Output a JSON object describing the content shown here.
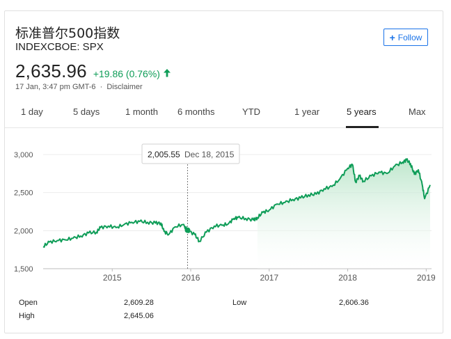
{
  "header": {
    "title": "标准普尔500指数",
    "ticker": "INDEXCBOE: SPX",
    "follow_label": "Follow"
  },
  "quote": {
    "price": "2,635.96",
    "change": "+19.86 (0.76%)",
    "timestamp": "17 Jan, 3:47 pm GMT-6",
    "separator": "·",
    "disclaimer": "Disclaimer"
  },
  "tabs": [
    {
      "label": "1 day"
    },
    {
      "label": "5 days"
    },
    {
      "label": "1 month"
    },
    {
      "label": "6 months"
    },
    {
      "label": "YTD"
    },
    {
      "label": "1 year"
    },
    {
      "label": "5 years",
      "active": true
    },
    {
      "label": "Max"
    }
  ],
  "tooltip": {
    "value": "2,005.55",
    "date": "Dec 18, 2015"
  },
  "stats": {
    "open_label": "Open",
    "open_value": "2,609.28",
    "high_label": "High",
    "high_value": "2,645.06",
    "low_label": "Low",
    "low_value": "2,606.36"
  },
  "colors": {
    "line": "#0f9d58",
    "area_top": "#b7e4c7",
    "accent_blue": "#1a73e8"
  },
  "chart_data": {
    "type": "area",
    "y_tick_labels": [
      "3,000",
      "2,500",
      "2,000",
      "1,500"
    ],
    "y_ticks": [
      3000,
      2500,
      2000,
      1500
    ],
    "ylim": [
      1500,
      3100
    ],
    "x_tick_labels": [
      "2015",
      "2016",
      "2017",
      "2018",
      "2019"
    ],
    "x_ticks": [
      2015,
      2016,
      2017,
      2018,
      2019
    ],
    "xlim": [
      2014.12,
      2019.05
    ],
    "grid": true,
    "series": [
      {
        "x": [
          2014.12,
          2014.2,
          2014.3,
          2014.4,
          2014.5,
          2014.6,
          2014.7,
          2014.8,
          2014.85,
          2014.95,
          2015.05,
          2015.15,
          2015.25,
          2015.35,
          2015.45,
          2015.55,
          2015.62,
          2015.66,
          2015.72,
          2015.8,
          2015.9,
          2015.96,
          2016.05,
          2016.11,
          2016.2,
          2016.3,
          2016.4,
          2016.48,
          2016.55,
          2016.6,
          2016.7,
          2016.8,
          2016.85,
          2016.92,
          2017.0,
          2017.1,
          2017.2,
          2017.3,
          2017.4,
          2017.5,
          2017.6,
          2017.7,
          2017.8,
          2017.9,
          2018.0,
          2018.06,
          2018.1,
          2018.15,
          2018.2,
          2018.3,
          2018.4,
          2018.5,
          2018.6,
          2018.7,
          2018.75,
          2018.8,
          2018.85,
          2018.9,
          2018.95,
          2018.98,
          2019.05
        ],
        "y": [
          1790,
          1850,
          1870,
          1880,
          1900,
          1930,
          1970,
          1980,
          2040,
          2060,
          2040,
          2080,
          2110,
          2120,
          2110,
          2100,
          2100,
          1990,
          1950,
          2050,
          2080,
          2005,
          1950,
          1860,
          1980,
          2060,
          2070,
          2090,
          2160,
          2170,
          2160,
          2140,
          2170,
          2240,
          2270,
          2350,
          2370,
          2410,
          2430,
          2470,
          2480,
          2550,
          2580,
          2680,
          2820,
          2870,
          2640,
          2720,
          2650,
          2720,
          2770,
          2750,
          2850,
          2900,
          2930,
          2880,
          2740,
          2800,
          2600,
          2420,
          2600
        ]
      }
    ]
  }
}
